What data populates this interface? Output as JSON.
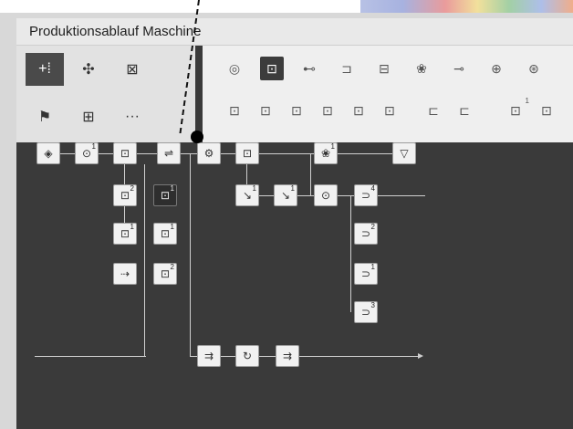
{
  "window": {
    "title": "Produktionsablauf Maschine"
  },
  "toolbar_left": {
    "row1": [
      {
        "name": "add-grid-icon",
        "glyph": "+⁞"
      },
      {
        "name": "move-icon",
        "glyph": "✣"
      },
      {
        "name": "delete-box-icon",
        "glyph": "⊠"
      }
    ],
    "row2": [
      {
        "name": "flag-icon",
        "glyph": "⚑"
      },
      {
        "name": "tree-icon",
        "glyph": "⊞"
      },
      {
        "name": "more-icon",
        "glyph": "···"
      }
    ]
  },
  "toolbar_right": {
    "row1": [
      "◎",
      "⊡",
      "⊷",
      "⊐",
      "⊟",
      "❀",
      "⊸",
      "⊕",
      "⊛"
    ],
    "row2": [
      "⊡",
      "⊡",
      "⊡",
      "⊡",
      "⊡",
      "⊡",
      "⊏",
      "⊏",
      "⊡",
      "⊡"
    ],
    "row2_sup": [
      "",
      "",
      "",
      "",
      "",
      "",
      "",
      "",
      "1",
      ""
    ]
  },
  "diagram": {
    "nodes_top": [
      {
        "glyph": "◈",
        "sup": ""
      },
      {
        "glyph": "⊙",
        "sup": "1"
      },
      {
        "glyph": "⊡",
        "sup": ""
      },
      {
        "glyph": "⇌",
        "sup": ""
      },
      {
        "glyph": "⚙",
        "sup": ""
      },
      {
        "glyph": "⊡",
        "sup": ""
      },
      {
        "glyph": "❀",
        "sup": "1"
      },
      {
        "glyph": "▽",
        "sup": ""
      }
    ],
    "col_a": [
      {
        "glyph": "⊡",
        "sup": "2"
      },
      {
        "glyph": "⊡",
        "sup": "1"
      },
      {
        "glyph": "⇢",
        "sup": ""
      }
    ],
    "col_b": [
      {
        "glyph": "⊡",
        "sup": "1"
      },
      {
        "glyph": "⊡",
        "sup": "1"
      },
      {
        "glyph": "⊡",
        "sup": "2"
      }
    ],
    "mid": [
      {
        "glyph": "↘",
        "sup": "1"
      },
      {
        "glyph": "↘",
        "sup": "1"
      },
      {
        "glyph": "⊙",
        "sup": ""
      }
    ],
    "right_col": [
      {
        "glyph": "⊃",
        "sup": "4"
      },
      {
        "glyph": "⊃",
        "sup": "2"
      },
      {
        "glyph": "⊃",
        "sup": "1"
      },
      {
        "glyph": "⊃",
        "sup": "3"
      }
    ],
    "bottom": [
      {
        "glyph": "⇉",
        "sup": ""
      },
      {
        "glyph": "↻",
        "sup": ""
      },
      {
        "glyph": "⇉",
        "sup": ""
      }
    ]
  }
}
